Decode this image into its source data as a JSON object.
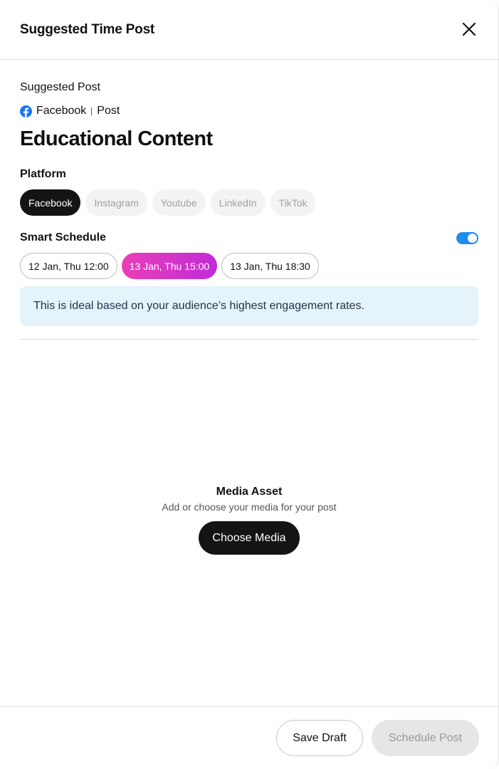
{
  "header": {
    "title": "Suggested Time Post",
    "close_icon": "close-icon"
  },
  "suggested": {
    "label": "Suggested Post",
    "source_icon": "facebook-icon",
    "source_platform": "Facebook",
    "source_type": "Post",
    "title": "Educational Content"
  },
  "platform": {
    "label": "Platform",
    "items": [
      {
        "label": "Facebook",
        "active": true
      },
      {
        "label": "Instagram",
        "active": false
      },
      {
        "label": "Youtube",
        "active": false
      },
      {
        "label": "LinkedIn",
        "active": false
      },
      {
        "label": "TikTok",
        "active": false
      }
    ]
  },
  "schedule": {
    "label": "Smart Schedule",
    "toggle_on": true,
    "times": [
      {
        "label": "12 Jan, Thu 12:00",
        "active": false
      },
      {
        "label": "13 Jan, Thu 15:00",
        "active": true
      },
      {
        "label": "13 Jan, Thu 18:30",
        "active": false
      }
    ],
    "info": "This is ideal based on your audience’s highest engagement rates."
  },
  "media": {
    "title": "Media Asset",
    "subtitle": "Add or choose your media for your post",
    "button_label": "Choose Media"
  },
  "footer": {
    "save_label": "Save Draft",
    "schedule_label": "Schedule Post"
  },
  "colors": {
    "facebook_blue": "#1877F2",
    "toggle_blue": "#1F8CEB",
    "active_time_gradient_start": "#E93FB6",
    "active_time_gradient_end": "#C22BD8",
    "info_background": "#E5F3FB",
    "primary_dark": "#141414"
  }
}
